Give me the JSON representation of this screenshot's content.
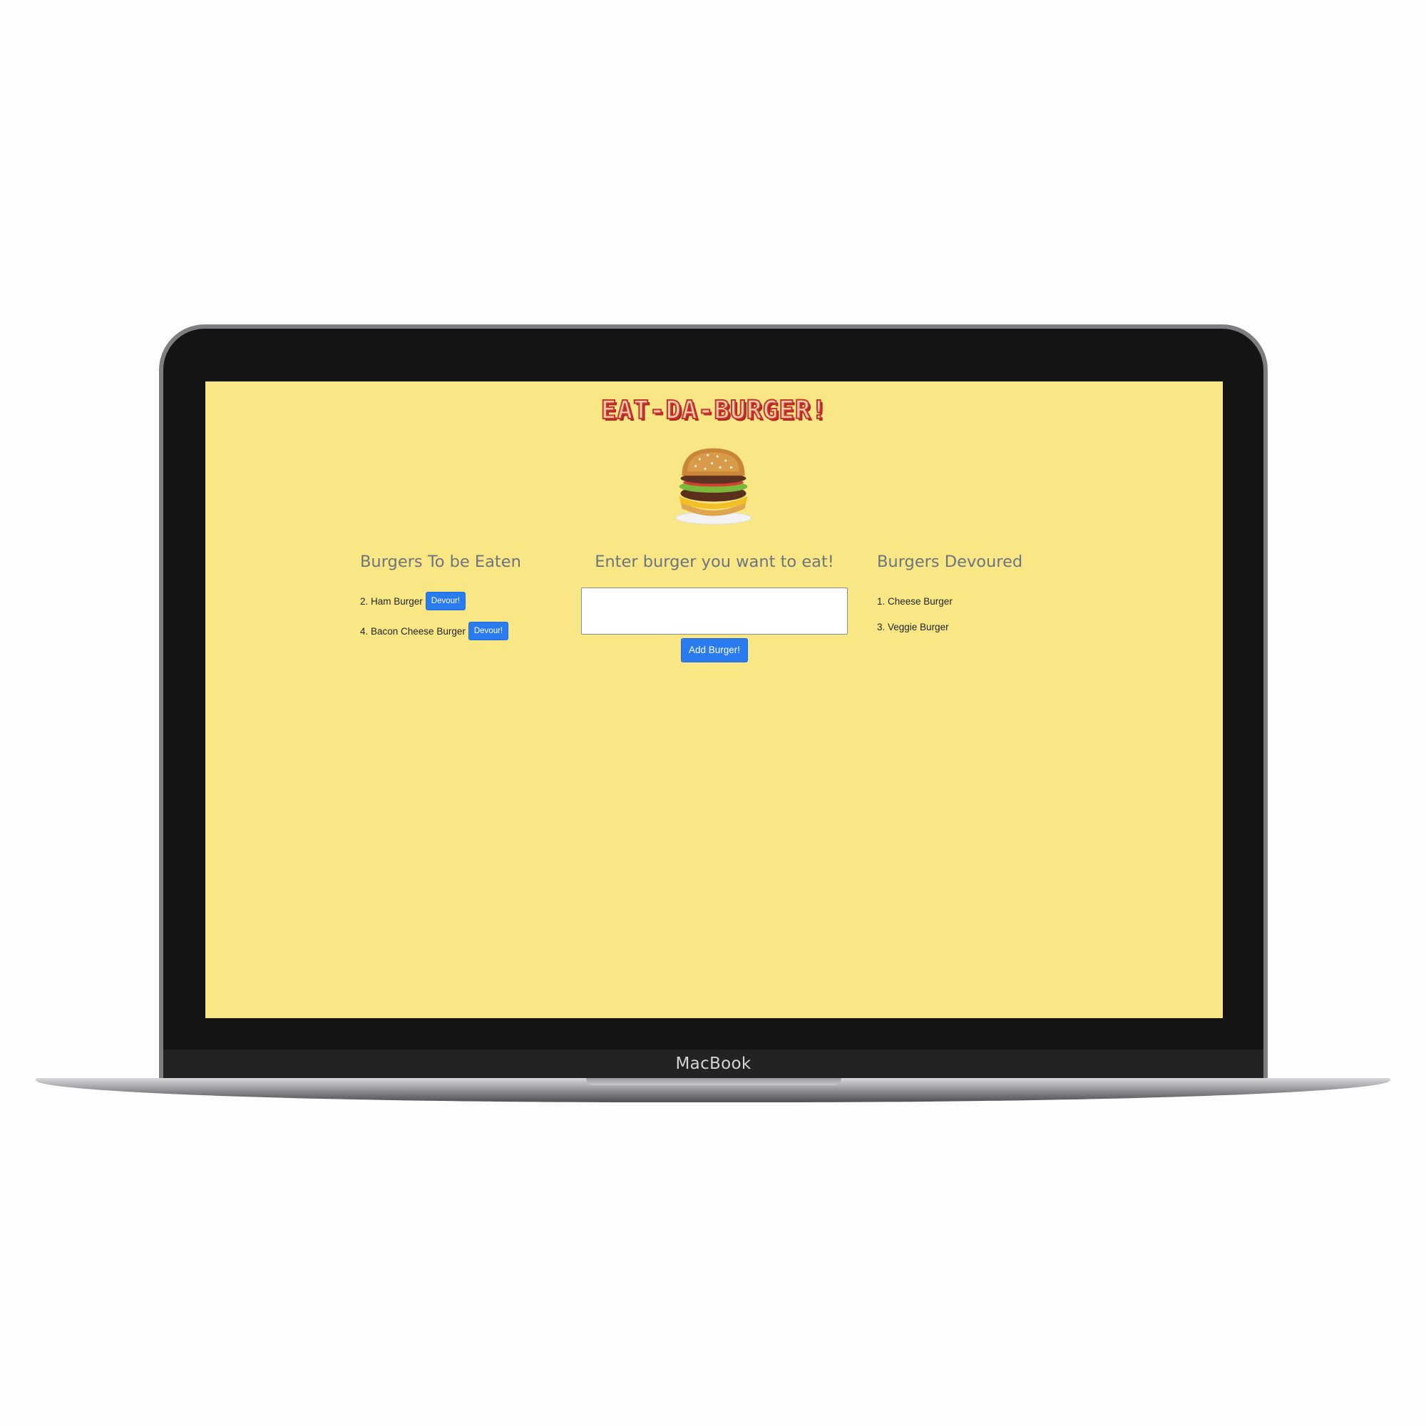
{
  "device": {
    "brand_label": "MacBook"
  },
  "app": {
    "title": "EAT-DA-BURGER!",
    "logo_icon": "hamburger-icon",
    "background_color": "#f9e786",
    "accent_color": "#2a7bf0",
    "title_color": "#c8362b"
  },
  "to_eat": {
    "heading": "Burgers To be Eaten",
    "items": [
      {
        "label": "2. Ham Burger",
        "button_label": "Devour!"
      },
      {
        "label": "4. Bacon Cheese Burger",
        "button_label": "Devour!"
      }
    ]
  },
  "add_form": {
    "heading": "Enter burger you want to eat!",
    "input_value": "",
    "button_label": "Add Burger!"
  },
  "devoured": {
    "heading": "Burgers Devoured",
    "items": [
      {
        "label": "1. Cheese Burger"
      },
      {
        "label": "3. Veggie Burger"
      }
    ]
  }
}
